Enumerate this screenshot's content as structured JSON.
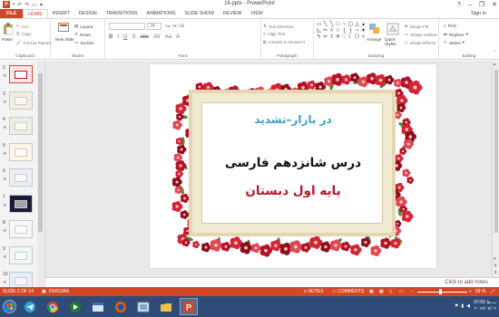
{
  "window": {
    "title": "16.pptx - PowerPoint",
    "controls": [
      "?",
      "–",
      "❐",
      "✕"
    ]
  },
  "ribbon_tabs": [
    "FILE",
    "HOME",
    "INSERT",
    "DESIGN",
    "TRANSITIONS",
    "ANIMATIONS",
    "SLIDE SHOW",
    "REVIEW",
    "VIEW"
  ],
  "active_tab": "HOME",
  "account": {
    "sign_in": "Sign in"
  },
  "clipboard": {
    "label": "Clipboard",
    "paste": "Paste",
    "cut": "Cut",
    "copy": "Copy",
    "format_painter": "Format Painter"
  },
  "slides_group": {
    "label": "Slides",
    "new_slide": "New Slide",
    "layout": "Layout",
    "reset": "Reset",
    "section": "Section"
  },
  "font_group": {
    "label": "Font",
    "size": "24"
  },
  "paragraph_group": {
    "label": "Paragraph",
    "text_direction": "Text Direction",
    "align_text": "Align Text",
    "convert_smartart": "Convert to SmartArt"
  },
  "drawing_group": {
    "label": "Drawing",
    "arrange": "Arrange",
    "quick_styles": "Quick Styles",
    "shape_fill": "Shape Fill",
    "shape_outline": "Shape Outline",
    "shape_effects": "Shape Effects"
  },
  "editing_group": {
    "label": "Editing",
    "find": "Find",
    "replace": "Replace",
    "select": "Select"
  },
  "thumbnails": [
    {
      "num": "2",
      "selected": true
    },
    {
      "num": "3",
      "selected": false
    },
    {
      "num": "4",
      "selected": false
    },
    {
      "num": "5",
      "selected": false
    },
    {
      "num": "6",
      "selected": false
    },
    {
      "num": "7",
      "selected": false
    },
    {
      "num": "8",
      "selected": false
    },
    {
      "num": "9",
      "selected": false
    },
    {
      "num": "10",
      "selected": false
    }
  ],
  "slide": {
    "line1": "در بازار–تشدید",
    "line2": "درس شانزدهم فارسی",
    "line3": "پایه اول دبستان",
    "color1": "#3aa0c8",
    "color2": "#111111",
    "color3": "#c0152b"
  },
  "notes": {
    "placeholder": "Click to add notes"
  },
  "status": {
    "slide_of": "SLIDE 2 OF 14",
    "language": "PERSIAN",
    "notes": "NOTES",
    "comments": "COMMENTS",
    "zoom": "69 %"
  },
  "taskbar": {
    "time": "07:55 ب.ظ",
    "date": "۲۰۱۹/۰۷/۰۲"
  },
  "colors": {
    "accent": "#d24726",
    "taskbar": "#2f4b77"
  }
}
